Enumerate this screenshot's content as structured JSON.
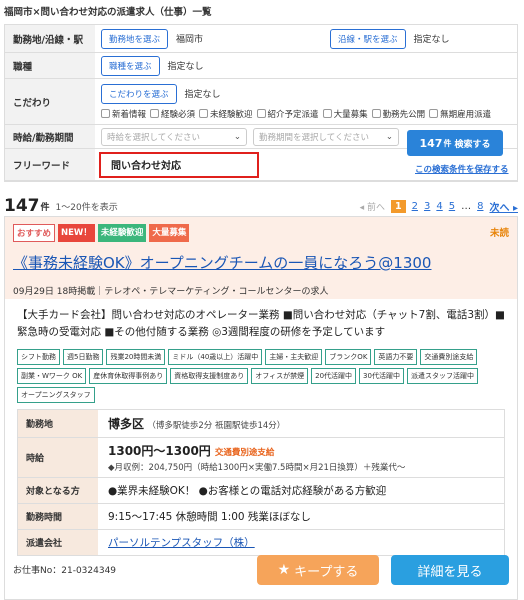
{
  "page_title": "福岡市×問い合わせ対応の派遣求人（仕事）一覧",
  "form": {
    "area": {
      "label": "勤務地/沿線・駅",
      "btn1": "勤務地を選ぶ",
      "val1": "福岡市",
      "btn2": "沿線・駅を選ぶ",
      "val2": "指定なし"
    },
    "job_type": {
      "label": "職種",
      "btn": "職種を選ぶ",
      "val": "指定なし"
    },
    "kodawari": {
      "label": "こだわり",
      "btn": "こだわりを選ぶ",
      "val": "指定なし",
      "checks": [
        "新着情報",
        "経験必須",
        "未経験歓迎",
        "紹介予定派遣",
        "大量募集",
        "勤務先公開",
        "無期雇用派遣"
      ]
    },
    "period": {
      "label": "時給/勤務期間",
      "select1": "時給を選択してください",
      "select2": "勤務期間を選択してください"
    },
    "freeword": {
      "label": "フリーワード",
      "value": "問い合わせ対応"
    },
    "search_count": "147",
    "search_unit": "件",
    "search_label": "検索する",
    "save_link": "この検索条件を保存する"
  },
  "results": {
    "count": "147",
    "unit": "件",
    "range": "1〜20件を表示",
    "prev": "◂ 前へ",
    "current_page": "1",
    "pages": [
      "2",
      "3",
      "4",
      "5"
    ],
    "ellipsis": "…",
    "last_page": "8",
    "next": "次へ ▸"
  },
  "job": {
    "badges": [
      "おすすめ",
      "NEW！",
      "未経験歓迎",
      "大量募集"
    ],
    "unread": "未読",
    "title": "《事務未経験OK》オープニングチームの一員になろう@1300",
    "posted": "09月29日 18時掲載｜テレオペ・テレマーケティング・コールセンターの求人",
    "description": "【大手カード会社】問い合わせ対応のオペレーター業務 ■問い合わせ対応（チャット7割、電話3割）■緊急時の受電対応 ■その他付随する業務 ◎3週間程度の研修を予定しています",
    "tags": [
      "シフト勤務",
      "週5日勤務",
      "残業20時間未満",
      "ミドル（40歳以上）活躍中",
      "主婦・主夫歓迎",
      "ブランクOK",
      "英語力不要",
      "交通費別途支給",
      "副業・Wワーク OK",
      "産休育休取得事例あり",
      "資格取得支援制度あり",
      "オフィスが禁煙",
      "20代活躍中",
      "30代活躍中",
      "派遣スタッフ活躍中",
      "オープニングスタッフ"
    ],
    "details": {
      "location_label": "勤務地",
      "location": "博多区",
      "location_sub": "（博多駅徒歩2分 祇園駅徒歩14分）",
      "wage_label": "時給",
      "wage": "1300円〜1300円",
      "wage_note": "交通費別途支給",
      "wage_sub": "◆月収例：204,750円（時給1300円×実働7.5時間×月21日換算）＋残業代〜",
      "target_label": "対象となる方",
      "target": "●業界未経験OK！ ●お客様との電話対応経験がある方歓迎",
      "hours_label": "勤務時間",
      "hours": "9:15〜17:45 休憩時間 1:00 残業ほぼなし",
      "company_label": "派遣会社",
      "company": "パーソルテンプスタッフ（株）"
    },
    "job_no": "お仕事No：21-0324349",
    "keep_label": "キープする",
    "detail_label": "詳細を見る"
  }
}
